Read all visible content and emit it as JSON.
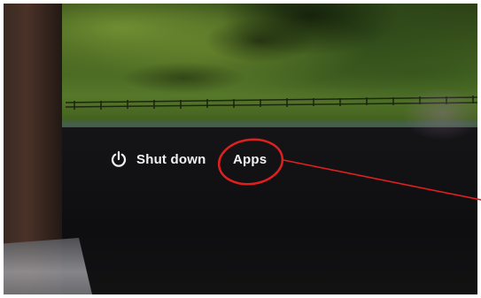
{
  "screen": {
    "shutdown_label": "Shut down",
    "shutdown_icon": "power-icon",
    "apps_label": "Apps"
  },
  "annotation": {
    "highlight_color": "#e01f1f",
    "shape": "ellipse-with-pointer-line"
  }
}
